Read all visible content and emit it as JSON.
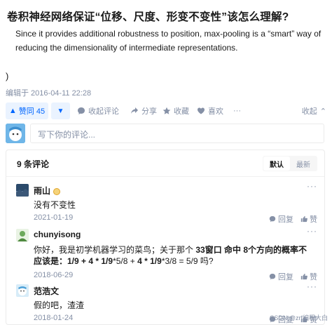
{
  "question": {
    "title": "卷积神经网络保证“位移、尺度、形变不变性”该怎么理解?",
    "body": "Since it provides additional robustness to position, max-pooling is a “smart” way of reducing the dimensionality of intermediate representations.",
    "paren": ")",
    "edited": "编辑于 2016-04-11 22:28"
  },
  "actions": {
    "upvote_label": "赞同 45",
    "comment_label": "收起评论",
    "share_label": "分享",
    "favorite_label": "收藏",
    "like_label": "喜欢",
    "more_label": "···",
    "collapse_label": "收起"
  },
  "comment_input": {
    "placeholder": "写下你的评论..."
  },
  "comments_header": {
    "count_label": "9 条评论",
    "sort_default": "默认",
    "sort_latest": "最新"
  },
  "comments": [
    {
      "name": "雨山",
      "text": "没有不变性",
      "date": "2021-01-19",
      "reply": "回复",
      "like": "赞",
      "more": "···"
    },
    {
      "name": "chunyisong",
      "text_pre": "你好，我是初学机器学习的菜鸟；关于那个 ",
      "text_bold": "33窗口 命中 8个方向的概率不应该是：1/9 + 4 * 1/9",
      "text_post": "*5/8 +",
      "text_bold2": "4 * 1/9",
      "text_post2": "*3/8 = 5/9 吗?",
      "date": "2018-06-29",
      "reply": "回复",
      "like": "赞",
      "more": "···"
    },
    {
      "name": "范浩文",
      "text": "假的吧，渣渣",
      "date": "2018-01-24",
      "reply": "回复",
      "like": "赞",
      "more": "···"
    }
  ],
  "watermark": "CSDN @zrf编程大白",
  "colors": {
    "accent": "#0066ff",
    "muted": "#8590a6",
    "vote_bg": "#eaf3ff"
  }
}
